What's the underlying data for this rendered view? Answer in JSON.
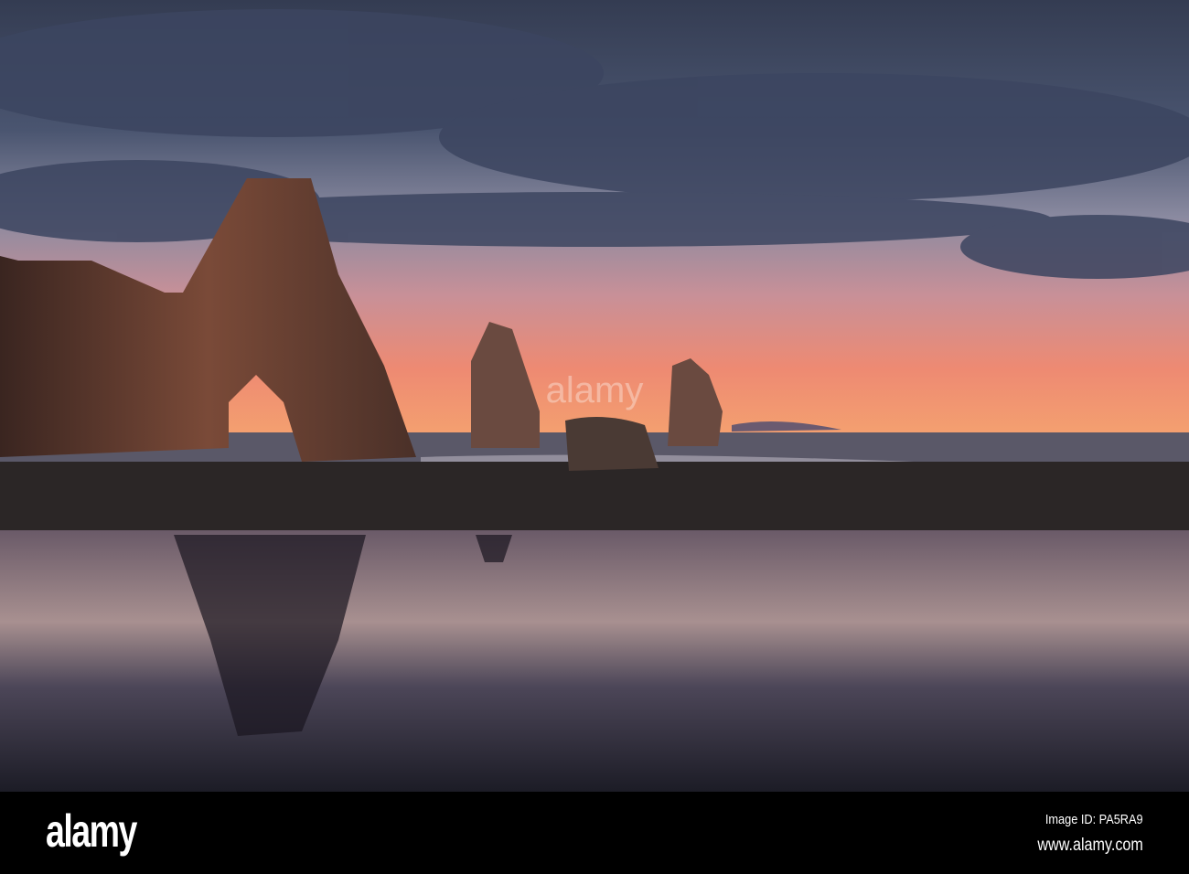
{
  "footer": {
    "logo": "alamy",
    "image_id": "Image ID: PA5RA9",
    "website": "www.alamy.com"
  },
  "watermark": "alamy",
  "colors": {
    "sky_top": "#3a4358",
    "horizon": "#f08a6a",
    "sand": "#2a2424"
  }
}
